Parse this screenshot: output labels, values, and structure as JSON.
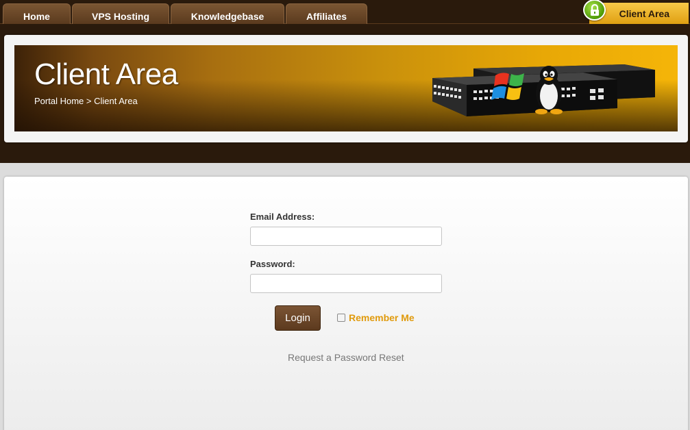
{
  "nav": {
    "tabs": [
      {
        "label": "Home"
      },
      {
        "label": "VPS Hosting"
      },
      {
        "label": "Knowledgebase"
      },
      {
        "label": "Affiliates"
      }
    ],
    "client_area_label": "Client Area"
  },
  "banner": {
    "title": "Client Area",
    "breadcrumb": {
      "home": "Portal Home",
      "separator": ">",
      "current": "Client Area"
    }
  },
  "login": {
    "email_label": "Email Address:",
    "email_value": "",
    "password_label": "Password:",
    "password_value": "",
    "login_button": "Login",
    "remember_label": "Remember Me",
    "remember_checked": false,
    "reset_link": "Request a Password Reset"
  },
  "colors": {
    "top_band": "#2a1a0c",
    "accent": "#e09a0c",
    "button": "#6b4728"
  },
  "icons": {
    "client_area": "lock-icon",
    "banner": "network-switch-with-windows-and-linux-logos"
  }
}
